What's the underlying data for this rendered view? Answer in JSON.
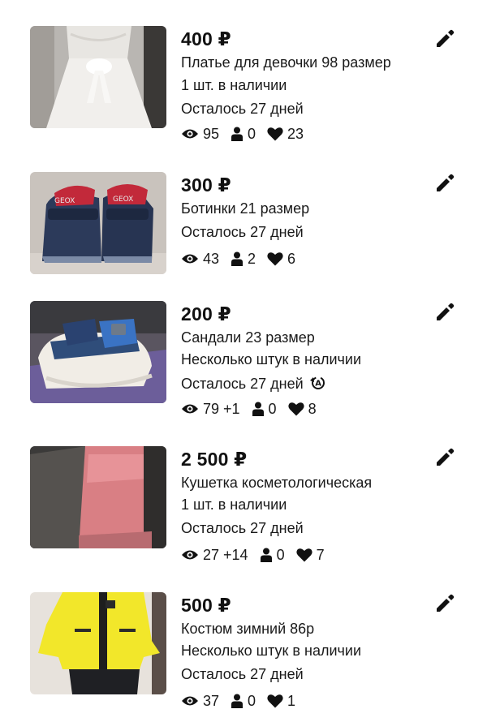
{
  "listings": [
    {
      "price": "400 ₽",
      "title": "Платье для девочки 98 размер",
      "availability": "1 шт. в наличии",
      "remaining": "Осталось 27 дней",
      "views": "95",
      "contacts": "0",
      "favorites": "23",
      "image": "white-girls-dress"
    },
    {
      "price": "300 ₽",
      "title": "Ботинки 21 размер",
      "remaining": "Осталось 27 дней",
      "views": "43",
      "contacts": "2",
      "favorites": "6",
      "image": "navy-kids-shoes"
    },
    {
      "price": "200 ₽",
      "title": "Сандали 23 размер",
      "availability": "Несколько штук в наличии",
      "remaining": "Осталось 27 дней",
      "views": "79 +1",
      "contacts": "0",
      "favorites": "8",
      "remaining_icon": "auto-renew-icon",
      "image": "blue-kids-sandals"
    },
    {
      "price": "2 500 ₽",
      "title": "Кушетка косметологическая",
      "availability": "1 шт. в наличии",
      "remaining": "Осталось 27 дней",
      "views": "27 +14",
      "contacts": "0",
      "favorites": "7",
      "image": "pink-cosmetology-couch"
    },
    {
      "price": "500 ₽",
      "title": "Костюм зимний 86р",
      "availability": "Несколько штук в наличии",
      "remaining": "Осталось 27 дней",
      "views": "37",
      "contacts": "0",
      "favorites": "1",
      "image": "yellow-winter-suit"
    }
  ],
  "icons": {
    "views": "eye-icon",
    "contacts": "person-icon",
    "favorites": "heart-icon",
    "edit": "pencil-icon"
  },
  "colors": {
    "text": "#111111",
    "background": "#ffffff"
  }
}
